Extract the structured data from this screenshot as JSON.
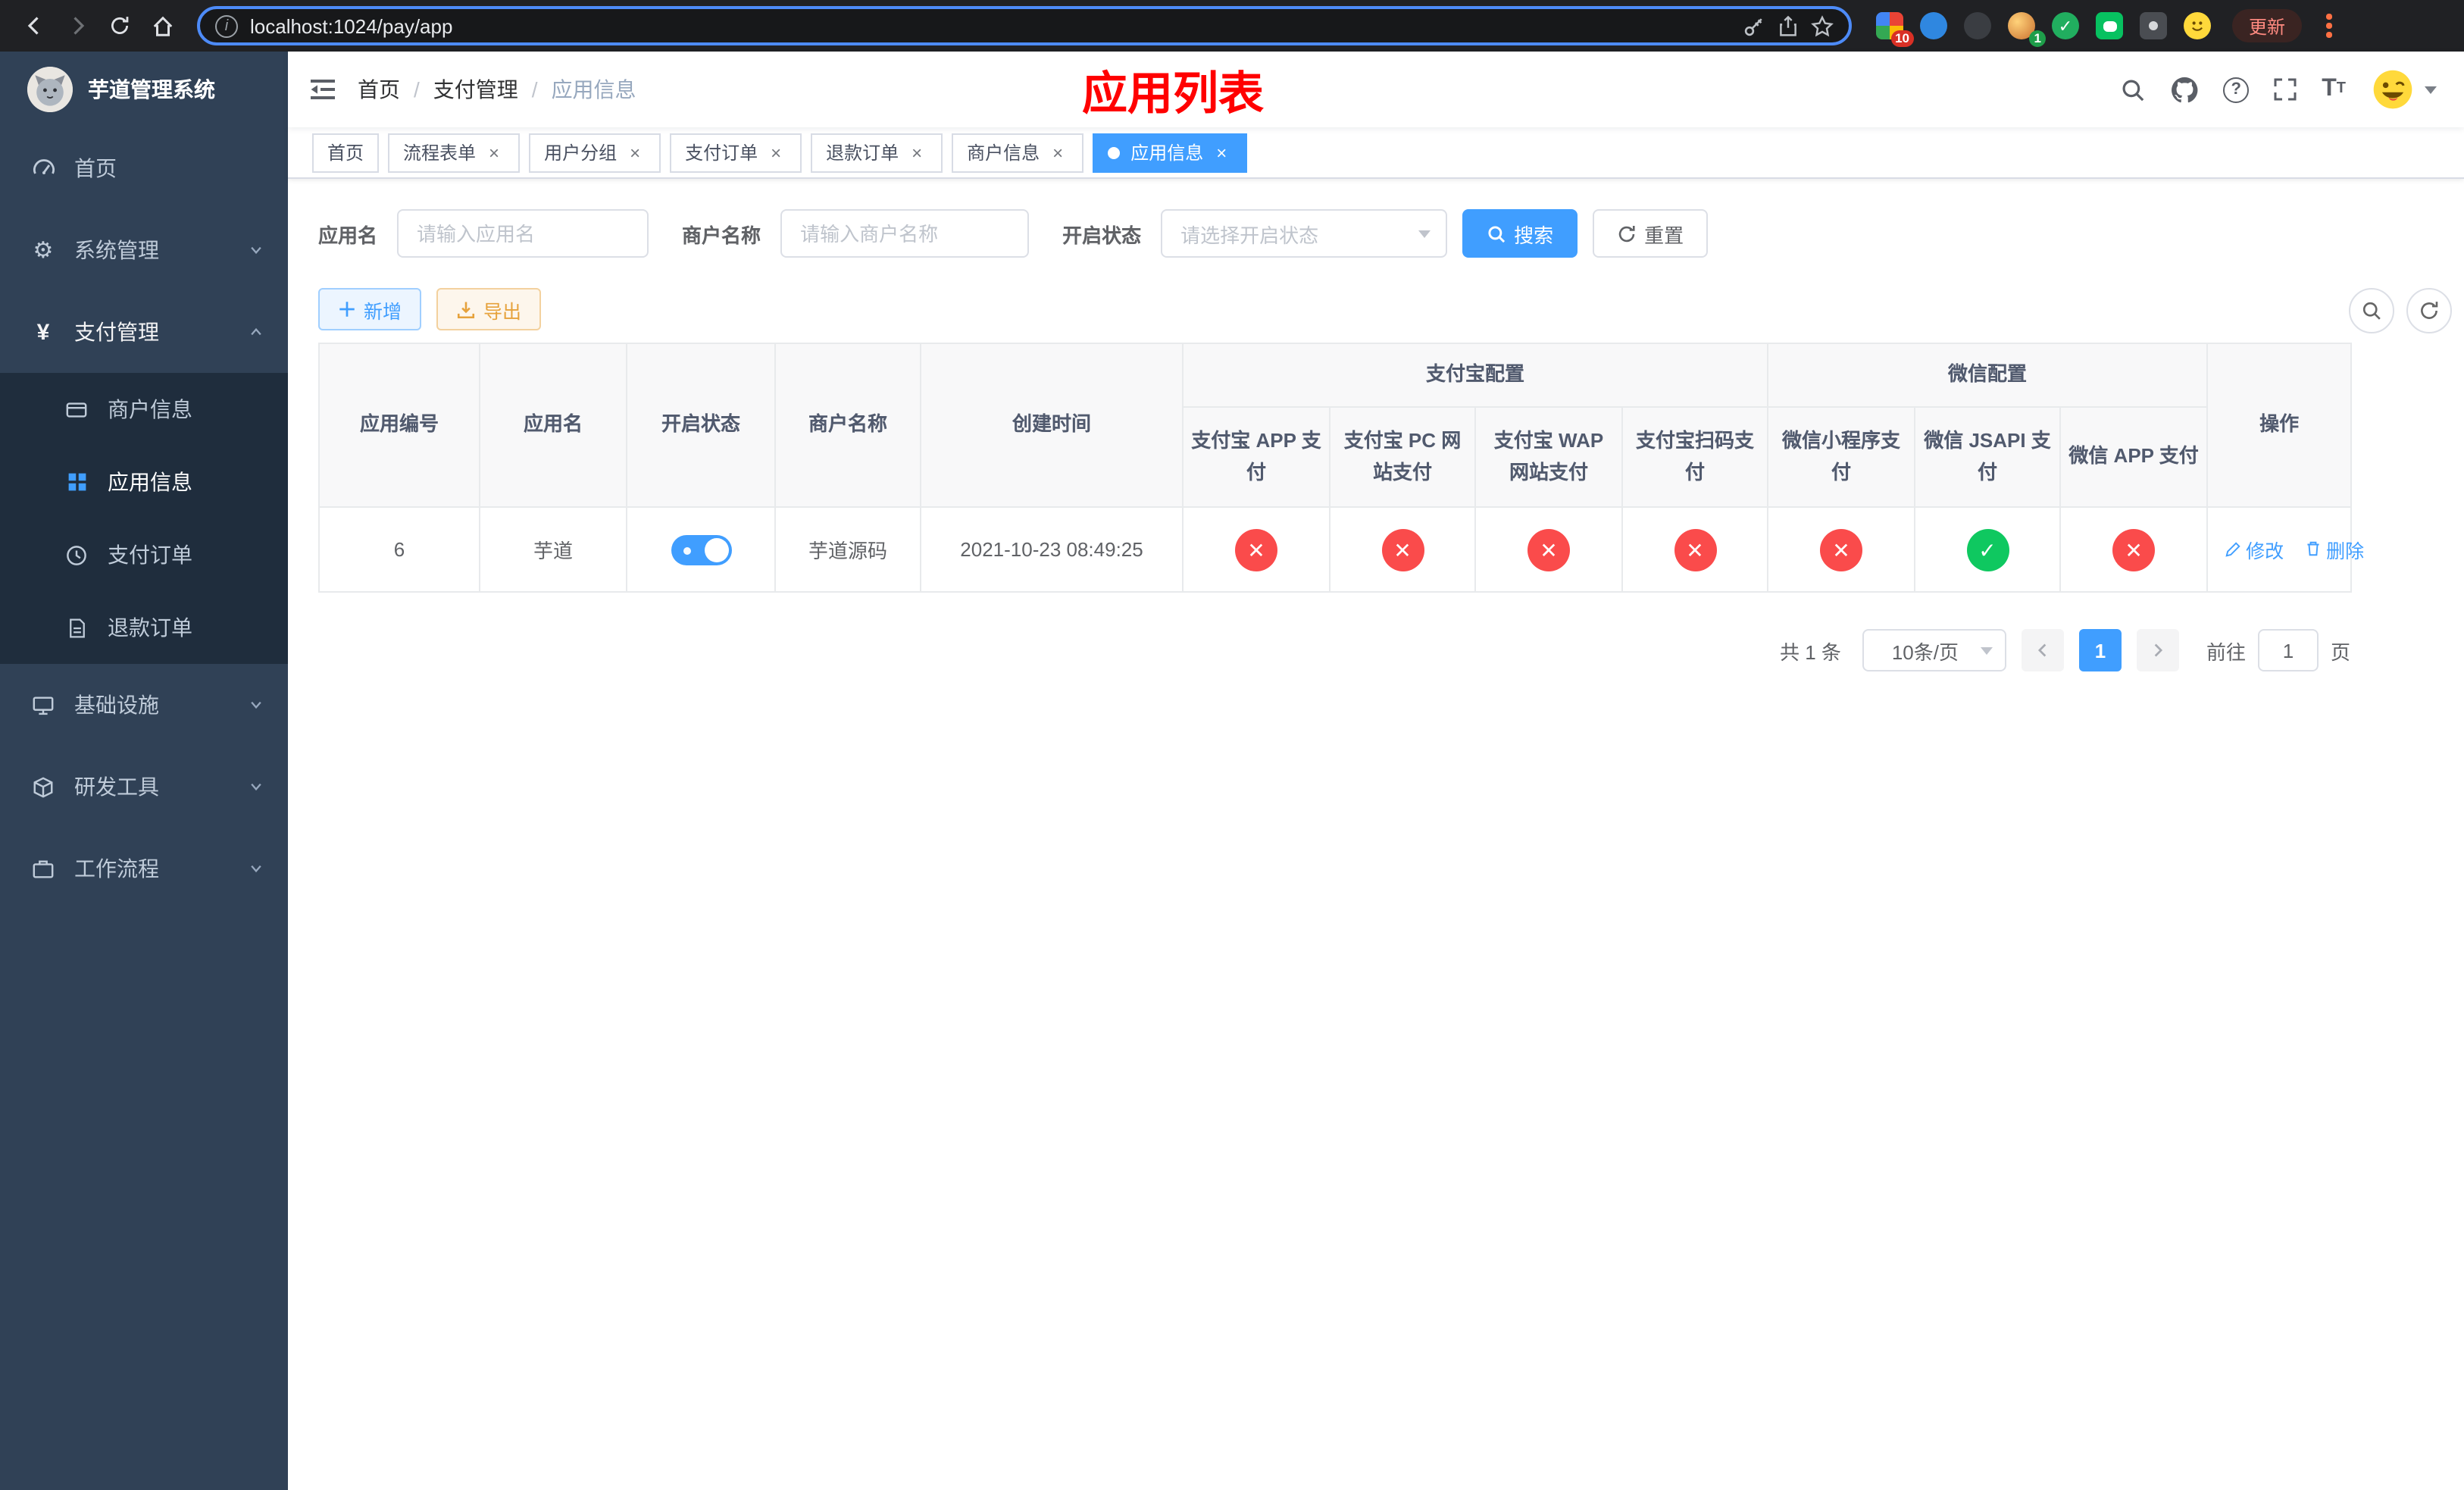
{
  "browser": {
    "url": "localhost:1024/pay/app",
    "update_label": "更新",
    "ext_badge_grid": "10",
    "ext_badge_avatar": "1"
  },
  "icons": {
    "check": "✓",
    "cross": "✕",
    "close": "×"
  },
  "sidebar": {
    "title": "芋道管理系统",
    "items": [
      {
        "label": "首页"
      },
      {
        "label": "系统管理"
      },
      {
        "label": "支付管理",
        "children": [
          {
            "label": "商户信息"
          },
          {
            "label": "应用信息"
          },
          {
            "label": "支付订单"
          },
          {
            "label": "退款订单"
          }
        ]
      },
      {
        "label": "基础设施"
      },
      {
        "label": "研发工具"
      },
      {
        "label": "工作流程"
      }
    ]
  },
  "header": {
    "breadcrumb": [
      "首页",
      "支付管理",
      "应用信息"
    ],
    "separator": "/",
    "title": "应用列表"
  },
  "tabs": [
    {
      "label": "首页"
    },
    {
      "label": "流程表单"
    },
    {
      "label": "用户分组"
    },
    {
      "label": "支付订单"
    },
    {
      "label": "退款订单"
    },
    {
      "label": "商户信息"
    },
    {
      "label": "应用信息"
    }
  ],
  "filters": {
    "app_name_label": "应用名",
    "app_name_placeholder": "请输入应用名",
    "merchant_label": "商户名称",
    "merchant_placeholder": "请输入商户名称",
    "status_label": "开启状态",
    "status_placeholder": "请选择开启状态",
    "search_label": "搜索",
    "reset_label": "重置"
  },
  "toolbar": {
    "add_label": "新增",
    "export_label": "导出"
  },
  "table": {
    "headers": {
      "id": "应用编号",
      "name": "应用名",
      "status": "开启状态",
      "merchant": "商户名称",
      "created": "创建时间",
      "ops": "操作",
      "alipay_group": "支付宝配置",
      "wechat_group": "微信配置",
      "alipay": [
        "支付宝 APP 支付",
        "支付宝 PC 网站支付",
        "支付宝 WAP 网站支付",
        "支付宝扫码支付"
      ],
      "wechat": [
        "微信小程序支付",
        "微信 JSAPI 支付",
        "微信 APP 支付"
      ]
    },
    "rows": [
      {
        "id": "6",
        "name": "芋道",
        "enabled": true,
        "merchant": "芋道源码",
        "created": "2021-10-23 08:49:25",
        "config": [
          false,
          false,
          false,
          false,
          false,
          true,
          false
        ],
        "edit_label": "修改",
        "delete_label": "删除"
      }
    ]
  },
  "pagination": {
    "total": "共 1 条",
    "size": "10条/页",
    "page": "1",
    "goto_prefix": "前往",
    "goto_value": "1",
    "goto_suffix": "页"
  }
}
